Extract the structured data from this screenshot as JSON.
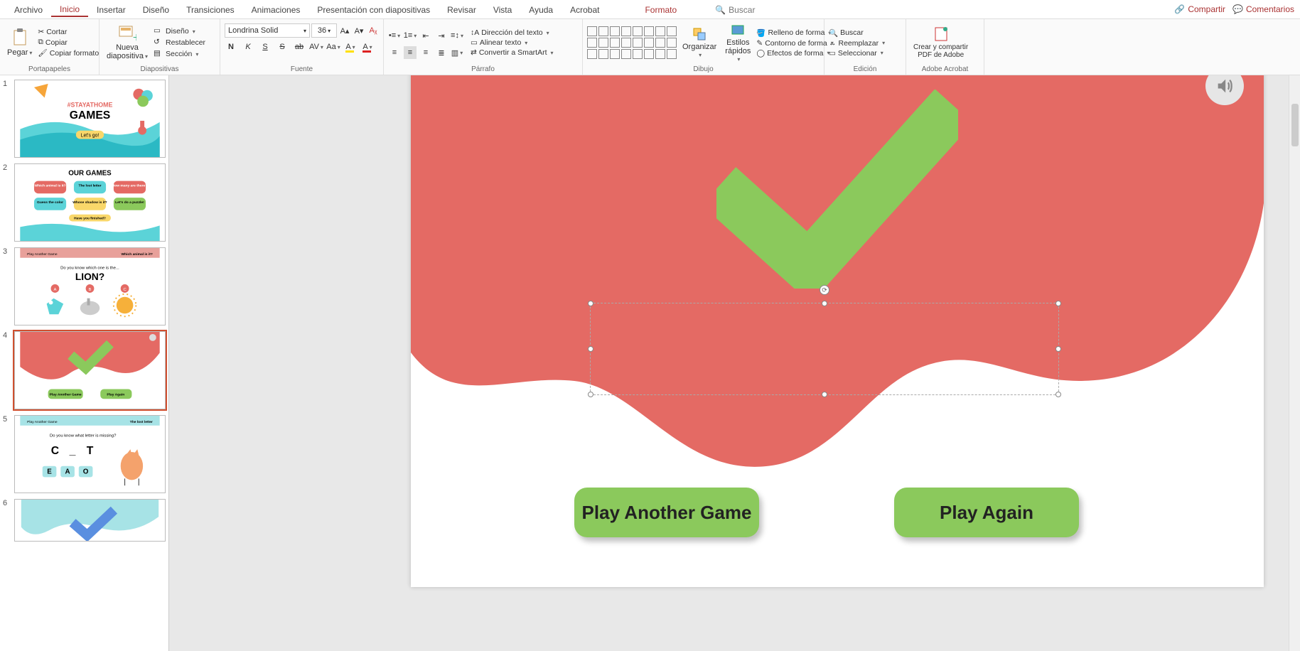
{
  "tabs": {
    "file": "Archivo",
    "home": "Inicio",
    "insert": "Insertar",
    "design": "Diseño",
    "transitions": "Transiciones",
    "animations": "Animaciones",
    "slideshow": "Presentación con diapositivas",
    "review": "Revisar",
    "view": "Vista",
    "help": "Ayuda",
    "acrobat": "Acrobat",
    "format": "Formato",
    "search": "Buscar"
  },
  "topright": {
    "share": "Compartir",
    "comments": "Comentarios"
  },
  "ribbon": {
    "clipboard": {
      "label": "Portapapeles",
      "paste": "Pegar",
      "cut": "Cortar",
      "copy": "Copiar",
      "formatpainter": "Copiar formato"
    },
    "slides": {
      "label": "Diapositivas",
      "newslide": "Nueva\ndiapositiva",
      "layout": "Diseño",
      "reset": "Restablecer",
      "section": "Sección"
    },
    "font": {
      "label": "Fuente",
      "name": "Londrina Solid",
      "size": "36"
    },
    "paragraph": {
      "label": "Párrafo",
      "textdir": "Dirección del texto",
      "align": "Alinear texto",
      "smartart": "Convertir a SmartArt"
    },
    "drawing": {
      "label": "Dibujo",
      "arrange": "Organizar",
      "quickstyles": "Estilos\nrápidos",
      "fill": "Relleno de forma",
      "outline": "Contorno de forma",
      "effects": "Efectos de forma"
    },
    "editing": {
      "label": "Edición",
      "find": "Buscar",
      "replace": "Reemplazar",
      "select": "Seleccionar"
    },
    "adobe": {
      "label": "Adobe Acrobat",
      "create": "Crear y compartir\nPDF de Adobe"
    }
  },
  "slides_panel": {
    "s1": "1",
    "s2": "2",
    "s3": "3",
    "s4": "4",
    "s5": "5",
    "s6": "6"
  },
  "slide": {
    "btn1": "Play Another Game",
    "btn2": "Play Again"
  },
  "thumbs": {
    "t1_tag": "#STAYATHOME",
    "t1_title": "GAMES",
    "t1_btn": "Let's go!",
    "t2_title": "OUR GAMES",
    "t2_b1": "Which animal is it?",
    "t2_b2": "The lost letter",
    "t2_b3": "How many are there?",
    "t2_b4": "Guess the color",
    "t2_b5": "Whose shadow is it?",
    "t2_b6": "Let's do a puzzle!",
    "t2_footer": "Have you finished?",
    "t3_hdr_l": "Play Another Game",
    "t3_hdr_r": "Which animal is it?",
    "t3_q": "Do you know which one is the...",
    "t3_a": "LION?",
    "t4_b1": "Play Another Game",
    "t4_b2": "Play Again",
    "t5_hdr_l": "Play Another Game",
    "t5_hdr_r": "The lost letter",
    "t5_q": "Do you know what letter is missing?",
    "t5_c": "C",
    "t5_t": "T",
    "t5_e": "E",
    "t5_a": "A",
    "t5_o": "O"
  }
}
